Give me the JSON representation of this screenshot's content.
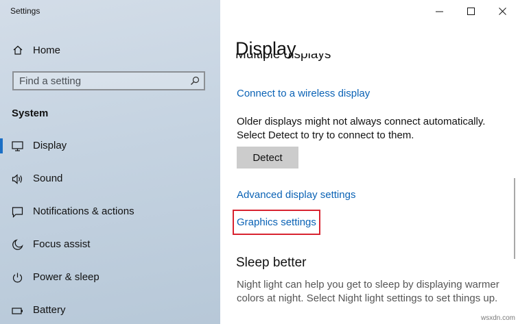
{
  "window": {
    "title": "Settings"
  },
  "sidebar": {
    "home_label": "Home",
    "search_placeholder": "Find a setting",
    "section_title": "System",
    "items": [
      {
        "label": "Display",
        "icon": "monitor-icon",
        "active": true
      },
      {
        "label": "Sound",
        "icon": "speaker-icon",
        "active": false
      },
      {
        "label": "Notifications & actions",
        "icon": "notification-icon",
        "active": false
      },
      {
        "label": "Focus assist",
        "icon": "moon-icon",
        "active": false
      },
      {
        "label": "Power & sleep",
        "icon": "power-icon",
        "active": false
      },
      {
        "label": "Battery",
        "icon": "battery-icon",
        "active": false
      }
    ]
  },
  "main": {
    "title": "Display",
    "partial_heading": "Multiple displays",
    "wireless_link": "Connect to a wireless display",
    "older_desc": "Older displays might not always connect automatically. Select Detect to try to connect to them.",
    "detect_button": "Detect",
    "advanced_link": "Advanced display settings",
    "graphics_link": "Graphics settings",
    "sleep_heading": "Sleep better",
    "sleep_desc": "Night light can help you get to sleep by displaying warmer colors at night. Select Night light settings to set things up."
  },
  "watermark": "wsxdn.com",
  "colors": {
    "accent": "#1b6fc5",
    "link": "#0a62b5",
    "highlight": "#d8222f",
    "close_button": "#1b6fc5"
  }
}
